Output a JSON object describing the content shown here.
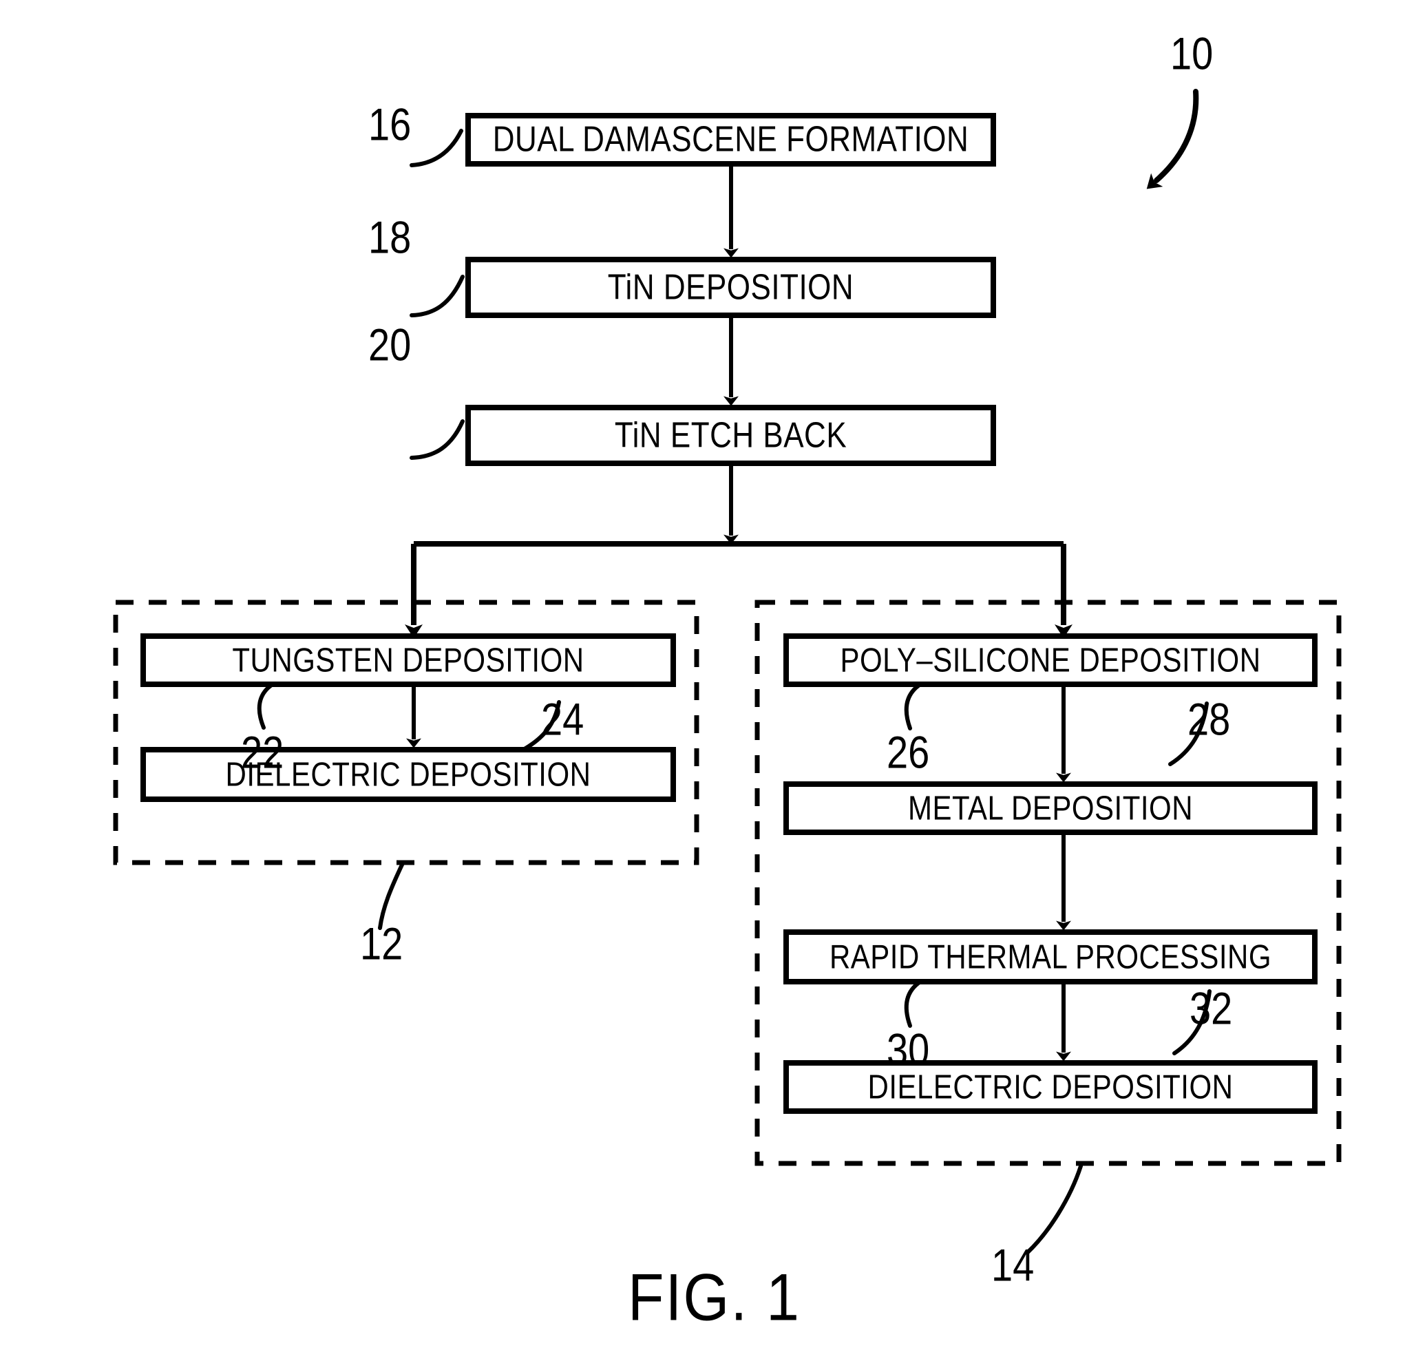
{
  "figure": {
    "caption": "FIG. 1",
    "overall_ref": "10"
  },
  "process_boxes": [
    {
      "id": "dual-damascene-formation",
      "label": "DUAL DAMASCENE FORMATION",
      "ref": "16"
    },
    {
      "id": "tin-deposition",
      "label": "TiN  DEPOSITION",
      "ref": "18"
    },
    {
      "id": "tin-etch-back",
      "label": "TiN  ETCH  BACK",
      "ref": "20"
    },
    {
      "id": "tungsten-deposition",
      "label": "TUNGSTEN  DEPOSITION",
      "ref": "22"
    },
    {
      "id": "dielectric-deposition-left",
      "label": "DIELECTRIC  DEPOSITION",
      "ref": "24"
    },
    {
      "id": "poly-silicone-deposition",
      "label": "POLY–SILICONE  DEPOSITION",
      "ref": "26"
    },
    {
      "id": "metal-deposition",
      "label": "METAL  DEPOSITION",
      "ref": "28"
    },
    {
      "id": "rapid-thermal-processing",
      "label": "RAPID  THERMAL  PROCESSING",
      "ref": "30"
    },
    {
      "id": "dielectric-deposition-right",
      "label": "DIELECTRIC  DEPOSITION",
      "ref": "32"
    }
  ],
  "branches": {
    "left": {
      "id": "tungsten-branch",
      "ref": "12"
    },
    "right": {
      "id": "poly-silicone-branch",
      "ref": "14"
    }
  },
  "labels": {
    "box_dual_damascene": "DUAL DAMASCENE FORMATION",
    "box_tin_deposition": "TiN  DEPOSITION",
    "box_tin_etch_back": "TiN  ETCH  BACK",
    "box_tungsten_deposition": "TUNGSTEN  DEPOSITION",
    "box_dielectric_left": "DIELECTRIC  DEPOSITION",
    "box_poly_silicone": "POLY–SILICONE  DEPOSITION",
    "box_metal_deposition": "METAL  DEPOSITION",
    "box_rapid_thermal": "RAPID  THERMAL  PROCESSING",
    "box_dielectric_right": "DIELECTRIC  DEPOSITION",
    "ref_10": "10",
    "ref_12": "12",
    "ref_14": "14",
    "ref_16": "16",
    "ref_18": "18",
    "ref_20": "20",
    "ref_22": "22",
    "ref_24": "24",
    "ref_26": "26",
    "ref_28": "28",
    "ref_30": "30",
    "ref_32": "32",
    "caption": "FIG. 1"
  },
  "colors": {
    "ink": "#000000",
    "paper": "#ffffff"
  }
}
